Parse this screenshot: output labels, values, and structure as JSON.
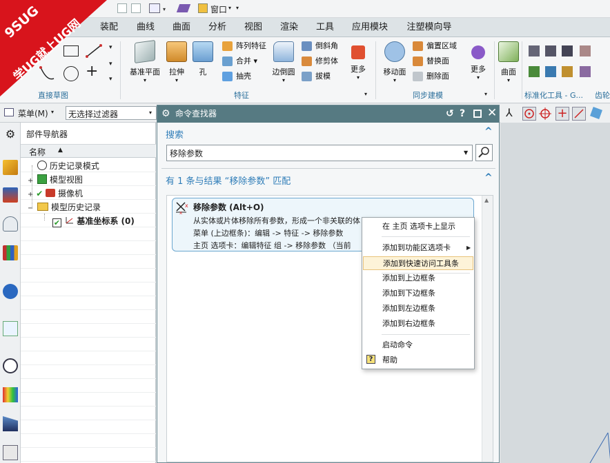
{
  "quick_access": {
    "window_label": "窗口"
  },
  "tabs": [
    "装配",
    "曲线",
    "曲面",
    "分析",
    "视图",
    "渲染",
    "工具",
    "应用模块",
    "注塑模向导"
  ],
  "watermark": {
    "line1": "9SUG",
    "line2": "学UG就上UG网"
  },
  "ribbon": {
    "sketch_group": "直接草图",
    "feature_group": "特征",
    "sync_group": "同步建模",
    "std_group": "标准化工具 - G...",
    "gear_group": "齿轮",
    "datum_plane": "基准平面",
    "extrude": "拉伸",
    "hole": "孔",
    "pattern_feature": "阵列特征",
    "unite": "合并",
    "shell": "抽壳",
    "edge_blend": "边倒圆",
    "chamfer": "倒斜角",
    "trim_body": "修剪体",
    "draft": "拔模",
    "more1": "更多",
    "move_face": "移动面",
    "offset_region": "偏置区域",
    "replace_face": "替换面",
    "delete_face": "删除面",
    "more2": "更多",
    "surface": "曲面"
  },
  "filterbar": {
    "menu_label": "菜单(M)",
    "filter_value": "无选择过滤器"
  },
  "navigator": {
    "title": "部件导航器",
    "col_name": "名称",
    "items": [
      {
        "label": "历史记录模式"
      },
      {
        "label": "模型视图"
      },
      {
        "label": "摄像机"
      },
      {
        "label": "模型历史记录"
      },
      {
        "label": "基准坐标系 (0)"
      }
    ]
  },
  "finder": {
    "title": "命令查找器",
    "search_header": "搜索",
    "search_value": "移除参数",
    "result_header": "有 1 条与结果 “移除参数” 匹配",
    "result": {
      "title": "移除参数 (Alt+O)",
      "desc": "从实体或片体移除所有参数，形成一个非关联的体",
      "menu_path": "菜单 (上边框条)：编辑 -> 特征 -> 移除参数",
      "tab_path": "主页 选项卡：编辑特征 组 -> 移除参数 （当前"
    }
  },
  "context_menu": {
    "items": [
      "在 主页 选项卡上显示",
      "添加到功能区选项卡",
      "添加到快速访问工具条",
      "添加到上边框条",
      "添加到下边框条",
      "添加到左边框条",
      "添加到右边框条",
      "启动命令",
      "帮助"
    ],
    "highlighted_index": 2
  },
  "colors": {
    "accent": "#2f7db8",
    "titlebar": "#567a82",
    "highlight": "#fdf3d8"
  }
}
